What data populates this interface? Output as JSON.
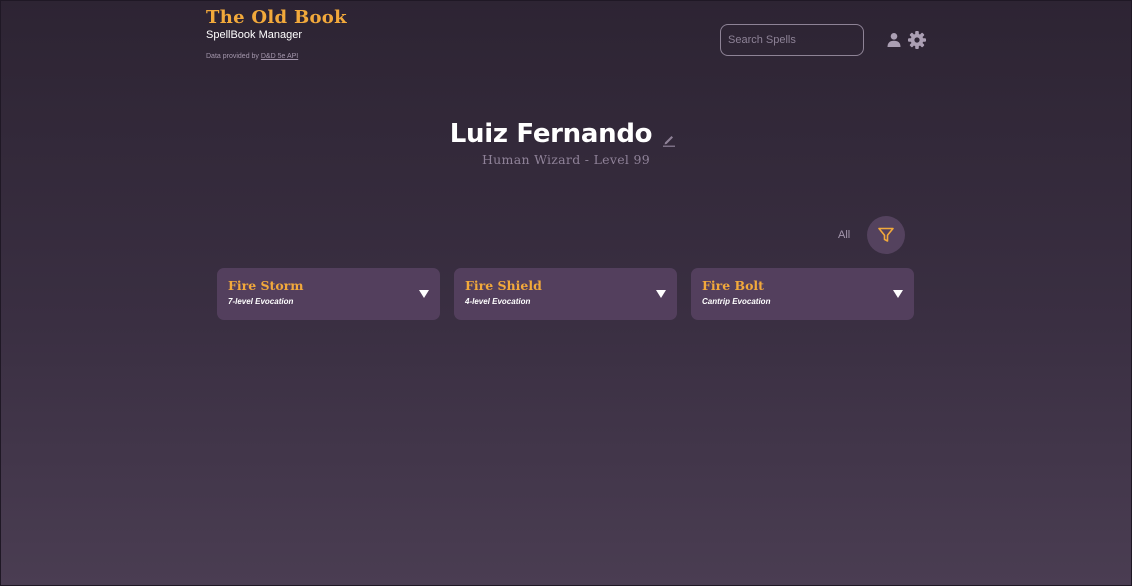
{
  "brand": {
    "title": "The Old Book",
    "subtitle": "SpellBook Manager",
    "credit_prefix": "Data provided by ",
    "credit_link": "D&D 5e API"
  },
  "search": {
    "placeholder": "Search Spells",
    "value": ""
  },
  "header_icons": {
    "user": "user-icon",
    "settings": "gear-icon"
  },
  "character": {
    "name": "Luiz Fernando",
    "description": "Human Wizard - Level 99",
    "edit_icon": "pencil-icon"
  },
  "filter": {
    "label": "All",
    "icon": "filter-icon"
  },
  "spells": [
    {
      "name": "Fire Storm",
      "detail": "7-level Evocation"
    },
    {
      "name": "Fire Shield",
      "detail": "4-level Evocation"
    },
    {
      "name": "Fire Bolt",
      "detail": "Cantrip Evocation"
    }
  ],
  "colors": {
    "accent": "#f2a93b",
    "card_background": "#533f5d",
    "background_top": "#2d2433",
    "background_bottom": "#4a3d52"
  }
}
